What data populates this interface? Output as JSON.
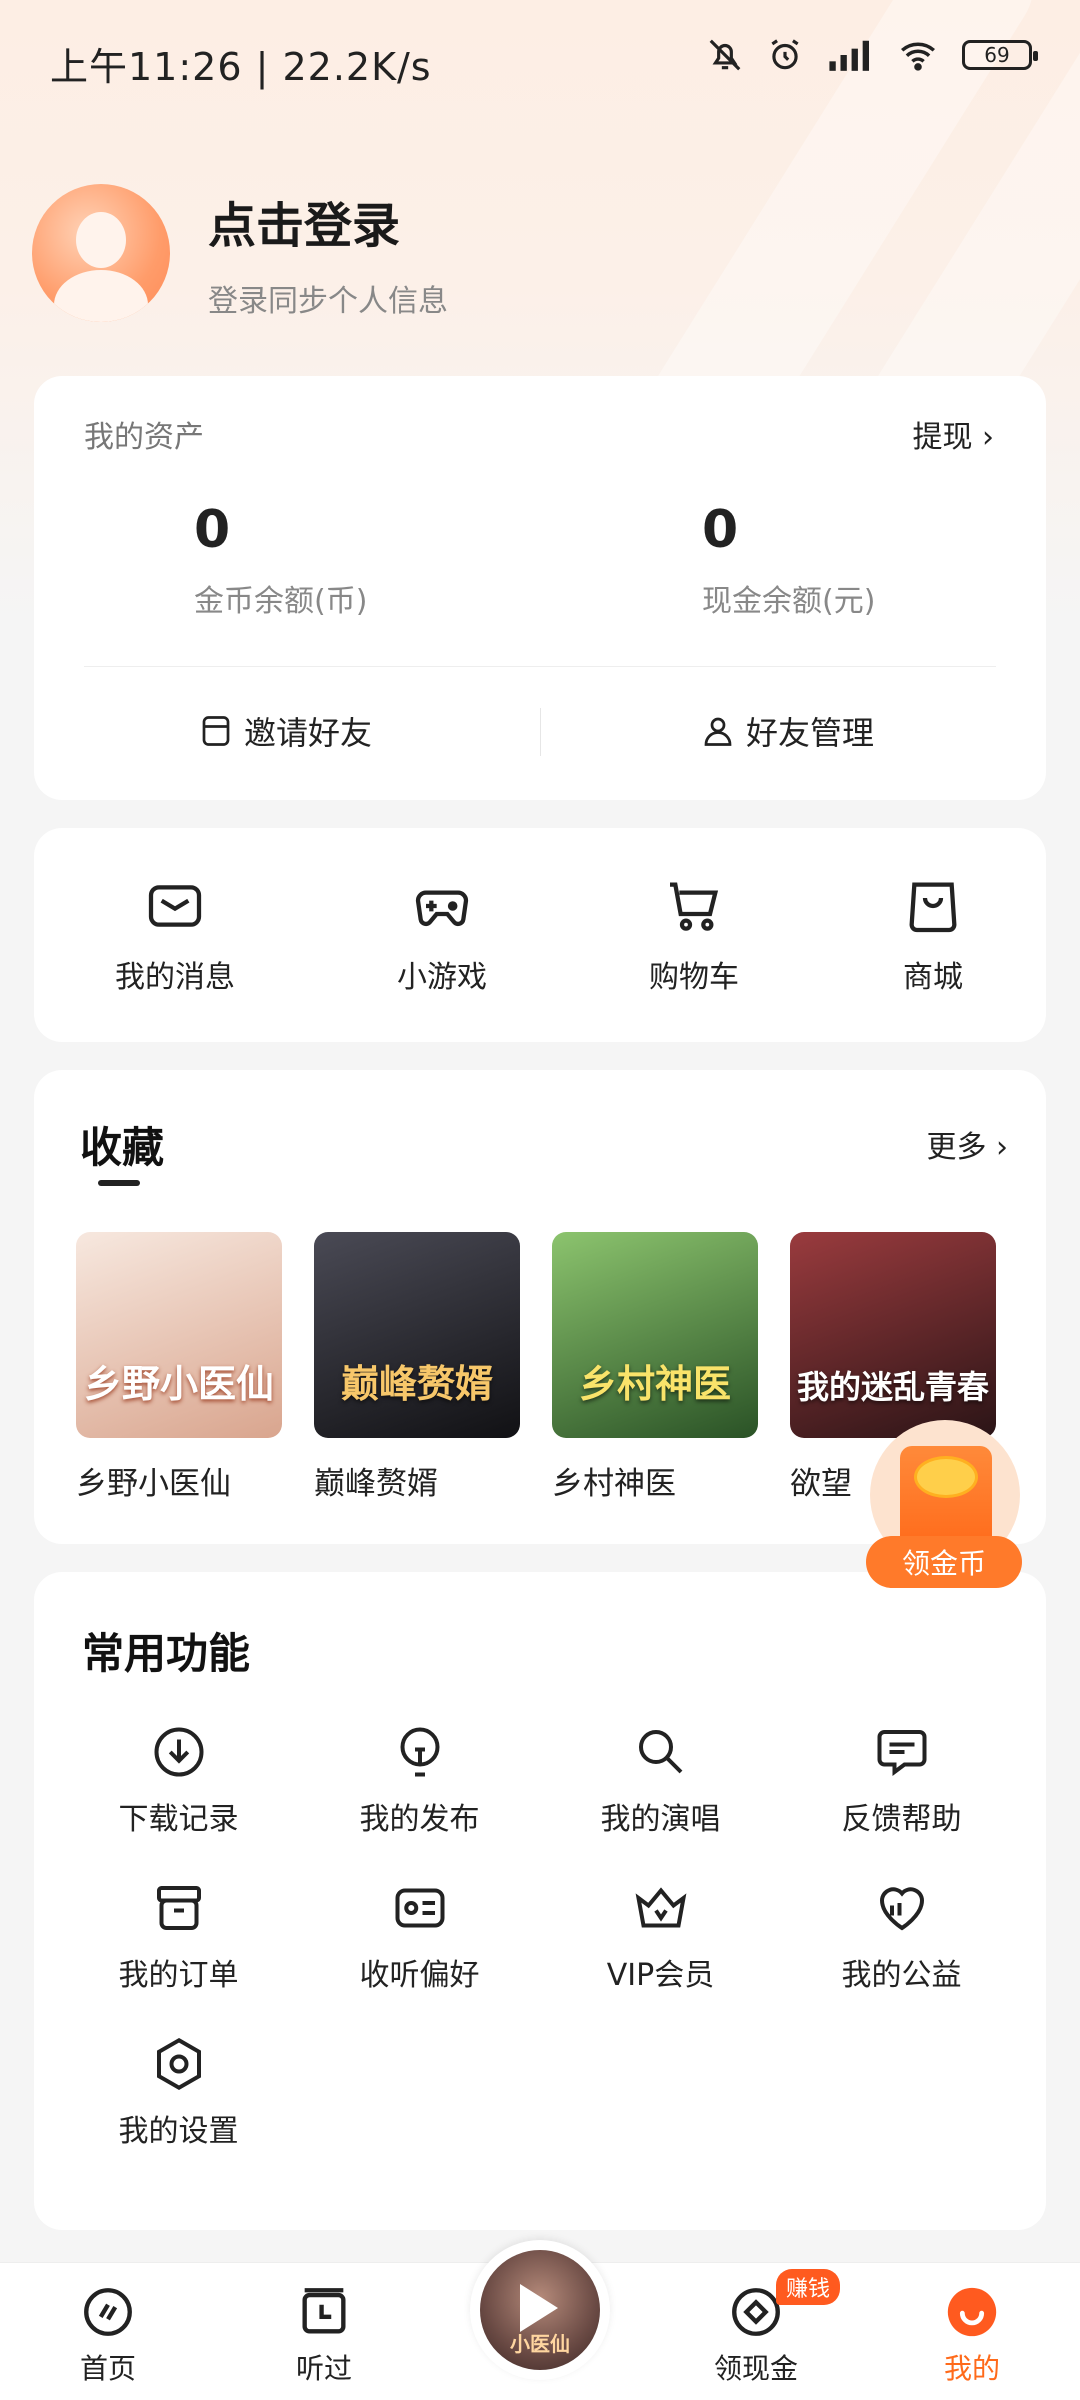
{
  "status_bar": {
    "time": "上午11:26 | 22.2K/s",
    "battery": "69"
  },
  "profile": {
    "title": "点击登录",
    "subtitle": "登录同步个人信息"
  },
  "assets": {
    "label": "我的资产",
    "withdraw": "提现 ›",
    "coin_value": "0",
    "coin_caption": "金币余额(币)",
    "cash_value": "0",
    "cash_caption": "现金余额(元)",
    "invite": "邀请好友",
    "friends": "好友管理"
  },
  "quick": [
    {
      "label": "我的消息",
      "icon": "mail-icon"
    },
    {
      "label": "小游戏",
      "icon": "gamepad-icon"
    },
    {
      "label": "购物车",
      "icon": "cart-icon"
    },
    {
      "label": "商城",
      "icon": "shopping-bag-icon"
    }
  ],
  "favorites": {
    "title": "收藏",
    "more": "更多 ›",
    "books": [
      {
        "name": "乡野小医仙",
        "cover_text": "乡野小医仙",
        "color_a": "#f3ddd2",
        "color_b": "#c98c74"
      },
      {
        "name": "巅峰赘婿",
        "cover_text": "巅峰赘婿",
        "color_a": "#3a3a42",
        "color_b": "#151518"
      },
      {
        "name": "乡村神医",
        "cover_text": "乡村神医",
        "color_a": "#6aa85a",
        "color_b": "#2d5a2a"
      },
      {
        "name": "欲望",
        "cover_text": "我的迷乱青春",
        "color_a": "#8a3a3a",
        "color_b": "#3a1a1e"
      }
    ]
  },
  "coin_float": {
    "label": "领金币"
  },
  "functions": {
    "title": "常用功能",
    "items": [
      {
        "label": "下载记录",
        "icon": "download-icon"
      },
      {
        "label": "我的发布",
        "icon": "bulb-icon"
      },
      {
        "label": "我的演唱",
        "icon": "microphone-icon"
      },
      {
        "label": "反馈帮助",
        "icon": "feedback-icon"
      },
      {
        "label": "我的订单",
        "icon": "order-box-icon"
      },
      {
        "label": "收听偏好",
        "icon": "preference-card-icon"
      },
      {
        "label": "VIP会员",
        "icon": "crown-icon"
      },
      {
        "label": "我的公益",
        "icon": "charity-heart-icon"
      },
      {
        "label": "我的设置",
        "icon": "settings-hexagon-icon"
      }
    ]
  },
  "tabbar": {
    "home": "首页",
    "history": "听过",
    "player_cover_text": "小医仙",
    "earn": "领现金",
    "earn_badge": "赚钱",
    "me": "我的",
    "active_color": "#ff6a1a"
  }
}
